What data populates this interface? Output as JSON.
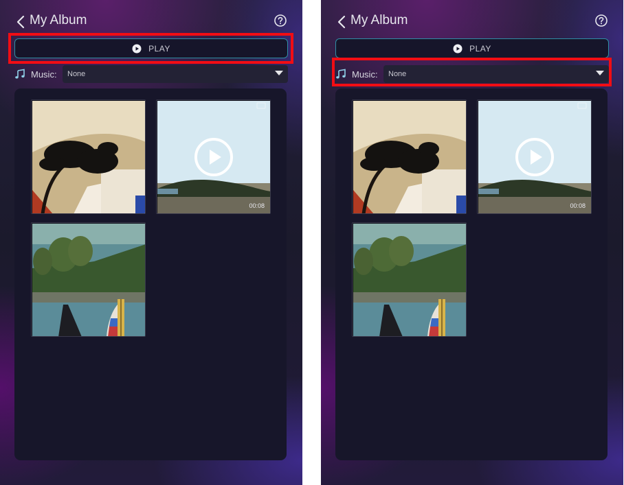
{
  "screens": [
    {
      "title": "My Album",
      "play_label": "PLAY",
      "music_label": "Music:",
      "music_value": "None",
      "media": [
        {
          "type": "photo"
        },
        {
          "type": "video",
          "duration": "00:08"
        },
        {
          "type": "photo"
        }
      ],
      "highlighted": "play-button"
    },
    {
      "title": "My Album",
      "play_label": "PLAY",
      "music_label": "Music:",
      "music_value": "None",
      "media": [
        {
          "type": "photo"
        },
        {
          "type": "video",
          "duration": "00:08"
        },
        {
          "type": "photo"
        }
      ],
      "highlighted": "music-row"
    }
  ],
  "icons": {
    "back": "chevron-left-icon",
    "help": "question-circle-icon",
    "play": "play-circle-icon",
    "music": "music-note-icon",
    "dropdown": "triangle-down-icon",
    "video_play": "play-circle-outline-icon"
  },
  "colors": {
    "highlight": "#f20d14",
    "play_border": "#2f8fa5",
    "music_icon": "#8fd0e8"
  }
}
